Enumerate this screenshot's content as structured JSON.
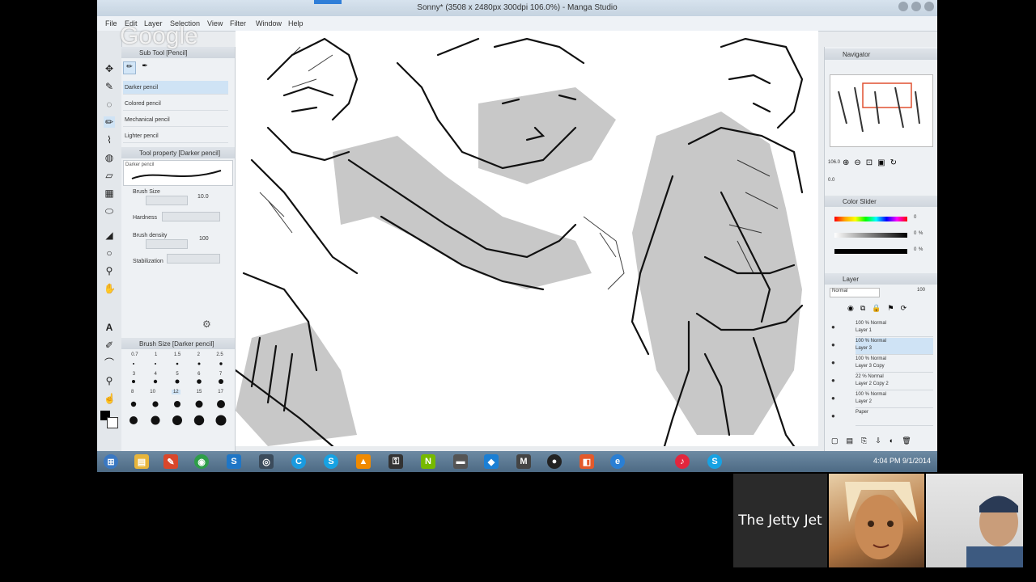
{
  "window": {
    "title": "Sonny* (3508 x 2480px 300dpi 106.0%) - Manga Studio"
  },
  "watermark": "Google",
  "menu": [
    "File",
    "Edit",
    "Layer",
    "Selection",
    "View",
    "Filter",
    "Window",
    "Help"
  ],
  "sub_tool": {
    "header": "Sub Tool [Pencil]",
    "items": [
      "Darker pencil",
      "Colored pencil",
      "Mechanical pencil",
      "Lighter pencil"
    ],
    "selected_index": 0
  },
  "tool_property": {
    "header": "Tool property [Darker pencil]",
    "preview_label": "Darker pencil",
    "brush_size_label": "Brush Size",
    "brush_size_value": "10.0",
    "hardness_label": "Hardness",
    "density_label": "Brush density",
    "density_value": "100",
    "stabilization_label": "Stabilization"
  },
  "brush_size_panel": {
    "header": "Brush Size [Darker pencil]",
    "row1": [
      "0.7",
      "1",
      "1.5",
      "2",
      "2.5"
    ],
    "row2": [
      "3",
      "4",
      "5",
      "6",
      "7"
    ],
    "row3": [
      "8",
      "10",
      "12",
      "15",
      "17"
    ],
    "selected": "12"
  },
  "navigator": {
    "header": "Navigator",
    "zoom": "106.0",
    "rotate": "0.0"
  },
  "color_slider": {
    "header": "Color Slider",
    "values": [
      "0",
      "0",
      "0"
    ],
    "units": [
      "",
      "%",
      "%"
    ]
  },
  "layer_panel": {
    "header": "Layer",
    "blend_mode": "Normal",
    "opacity": "100",
    "layers": [
      {
        "line1": "100 %  Normal",
        "line2": "Layer 1"
      },
      {
        "line1": "100 %  Normal",
        "line2": "Layer 3"
      },
      {
        "line1": "100 %  Normal",
        "line2": "Layer 3 Copy"
      },
      {
        "line1": "22 %  Normal",
        "line2": "Layer 2 Copy 2"
      },
      {
        "line1": "100 %  Normal",
        "line2": "Layer 2"
      },
      {
        "line1": "",
        "line2": "Paper"
      }
    ]
  },
  "taskbar": {
    "clock": "4:04 PM 9/1/2014",
    "icons": [
      "start-orb",
      "file-explorer",
      "paint-icon",
      "chrome-icon",
      "skype-icon",
      "steam-icon",
      "ccleaner-icon",
      "skype-icon-2",
      "vlc-icon",
      "usb-icon",
      "nvidia-icon",
      "flash-icon",
      "dropbox-icon",
      "manga-studio-icon",
      "obs-icon",
      "app-icon",
      "ie-icon",
      "itunes-icon",
      "skype-icon-3"
    ]
  },
  "hangout": {
    "name": "The Jetty Jet"
  }
}
